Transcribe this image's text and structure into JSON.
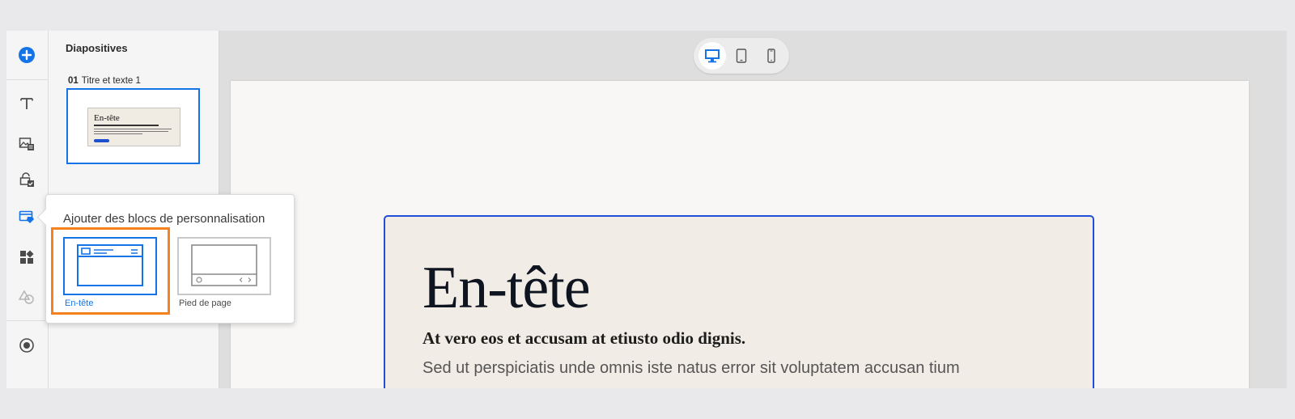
{
  "rail": {
    "items": [
      {
        "name": "add-icon"
      },
      {
        "name": "text-icon"
      },
      {
        "name": "image-icon"
      },
      {
        "name": "lock-check-icon"
      },
      {
        "name": "personalization-icon"
      },
      {
        "name": "widgets-icon"
      },
      {
        "name": "shapes-icon"
      },
      {
        "name": "record-icon"
      }
    ]
  },
  "slides_panel": {
    "title": "Diapositives",
    "slides": [
      {
        "number": "01",
        "title": "Titre et texte 1",
        "thumb_heading": "En-tête"
      }
    ]
  },
  "device_toggle": {
    "options": [
      "desktop-icon",
      "tablet-icon",
      "phone-icon"
    ],
    "selected": "desktop-icon"
  },
  "canvas": {
    "heading": "En-tête",
    "subheading": "At vero eos et accusam at etiusto odio dignis.",
    "body": "Sed ut perspiciatis unde omnis iste natus error sit voluptatem accusan tium"
  },
  "popover": {
    "title": "Ajouter des blocs de personnalisation",
    "options": [
      {
        "label": "En-tête",
        "selected": true
      },
      {
        "label": "Pied de page",
        "selected": false
      }
    ]
  },
  "colors": {
    "accent": "#1473e6",
    "highlight": "#f5821f",
    "block_border": "#1f4ed8"
  }
}
